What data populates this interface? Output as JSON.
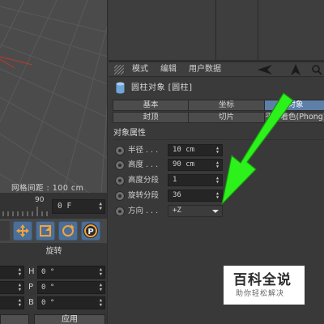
{
  "viewport": {
    "grid_label": "网格间距 : 100 cm"
  },
  "timeline": {
    "marker_number": "90",
    "frame_field": "0 F"
  },
  "toolbar": {
    "icons": [
      "move-icon",
      "scale-icon",
      "rotate-icon",
      "render-icon"
    ],
    "render_letter": "P"
  },
  "rotation_panel": {
    "header": "旋转",
    "rows": [
      {
        "letter": "H",
        "value": "0 °"
      },
      {
        "letter": "P",
        "value": "0 °"
      },
      {
        "letter": "B",
        "value": "0 °"
      }
    ],
    "apply_label": "应用"
  },
  "attribute_manager": {
    "menu": [
      "模式",
      "编辑",
      "用户数据"
    ],
    "object_title": "圆柱对象 [圆柱]",
    "tabs_row1": [
      {
        "label": "基本",
        "active": false
      },
      {
        "label": "坐标",
        "active": false
      },
      {
        "label": "对象",
        "active": true
      }
    ],
    "tabs_row2": [
      {
        "label": "封顶",
        "active": false
      },
      {
        "label": "切片",
        "active": false
      },
      {
        "label": "平滑着色(Phong)",
        "active": false
      }
    ],
    "section_title": "对象属性",
    "properties": [
      {
        "label": "半径 . . .",
        "value": "10 cm"
      },
      {
        "label": "高度 . . .",
        "value": "90 cm"
      },
      {
        "label": "高度分段",
        "value": "1"
      },
      {
        "label": "旋转分段",
        "value": "36"
      },
      {
        "label": "方向 . . .",
        "value": "+Z"
      }
    ]
  },
  "watermark": {
    "main": "百科全说",
    "sub": "助你轻松解决"
  },
  "colors": {
    "active_tab": "#5d7fa8",
    "tool_button": "#4b6f99",
    "annotation_arrow": "#2cf11b"
  }
}
